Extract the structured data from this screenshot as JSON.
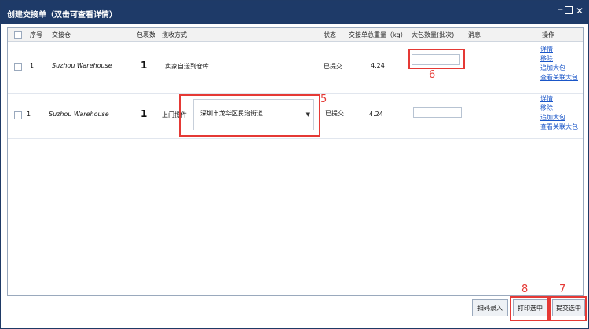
{
  "window": {
    "title": "创建交接单（双击可查看详情）",
    "min_icon": "minimize-icon",
    "max_icon": "maximize-icon",
    "close_icon": "close-icon"
  },
  "columns": [
    "序号",
    "交接仓",
    "包裹数",
    "揽收方式",
    "状态",
    "交接单总重量（kg）",
    "大包数量(批次)",
    "消息",
    "操作"
  ],
  "rows": [
    {
      "index": "1",
      "warehouse": "Suzhou Warehouse",
      "parcels": "1",
      "pickup": "卖家自送到仓库",
      "status": "已提交",
      "weight": "4.24",
      "bag_count_value": "",
      "actions": [
        "详情",
        "移除",
        "追加大包",
        "查看关联大包"
      ]
    },
    {
      "index": "1",
      "warehouse": "Suzhou Warehouse",
      "parcels": "1",
      "pickup_label": "上门揽件",
      "pickup_address": "深圳市龙华区民治街道",
      "status": "已提交",
      "weight": "4.24",
      "bag_count_value": "",
      "actions": [
        "详情",
        "移除",
        "追加大包",
        "查看关联大包"
      ]
    }
  ],
  "annotations": {
    "n5": "5",
    "n6": "6",
    "n7": "7",
    "n8": "8"
  },
  "footer": {
    "scan_label": "扫码录入",
    "print_label": "打印选中",
    "submit_label": "提交选中"
  },
  "colors": {
    "titlebar": "#1e3a68",
    "highlight": "#e53935",
    "link": "#1a56c8"
  }
}
